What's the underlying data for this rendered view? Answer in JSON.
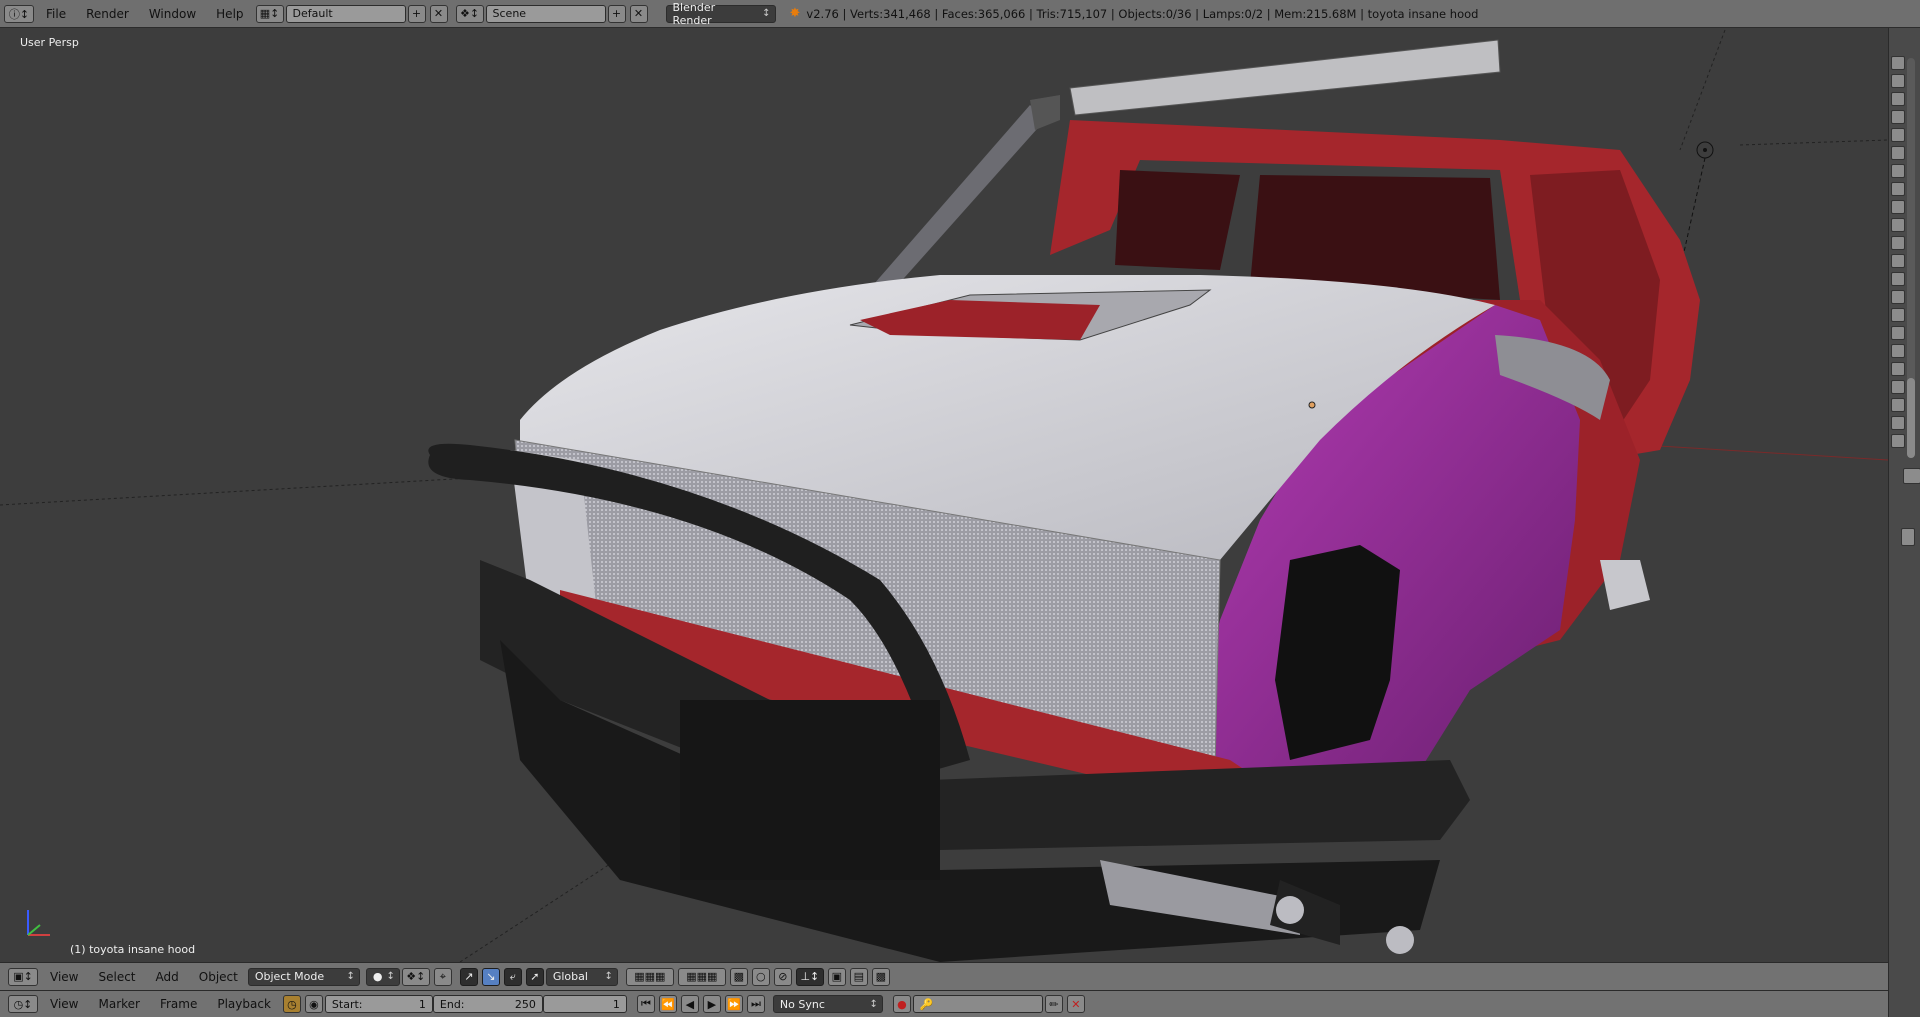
{
  "top": {
    "menus": [
      "File",
      "Render",
      "Window",
      "Help"
    ],
    "screen_layout": "Default",
    "scene": "Scene",
    "render_engine": "Blender Render",
    "stats": "v2.76 | Verts:341,468 | Faces:365,066 | Tris:715,107 | Objects:0/36 | Lamps:0/2 | Mem:215.68M | toyota insane hood"
  },
  "viewport": {
    "view_label": "User Persp",
    "object_label": "(1) toyota insane hood"
  },
  "view3d_header": {
    "menus": [
      "View",
      "Select",
      "Add",
      "Object"
    ],
    "mode": "Object Mode",
    "orientation": "Global"
  },
  "timeline": {
    "menus": [
      "View",
      "Marker",
      "Frame",
      "Playback"
    ],
    "start_label": "Start:",
    "start_value": "1",
    "end_label": "End:",
    "end_value": "250",
    "current_frame": "1",
    "sync": "No Sync"
  },
  "colors": {
    "background": "#3d3d3d",
    "header": "#727272",
    "body_red": "#a5262c",
    "fender_purple": "#9a2a9a",
    "hood_white": "#d8d8dc",
    "bumper_black": "#1f1f1f"
  }
}
